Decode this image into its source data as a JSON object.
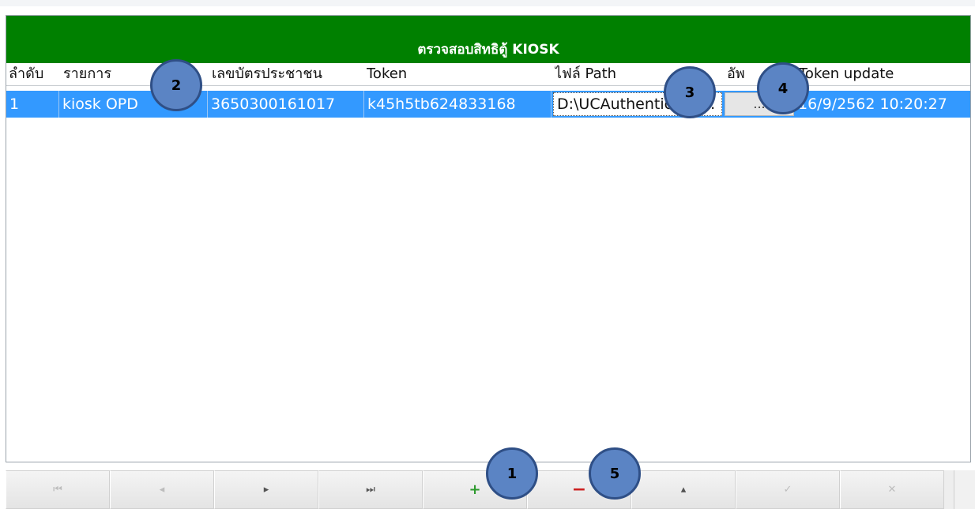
{
  "grid": {
    "title": "ตรวจสอบสิทธิตู้ KIOSK",
    "columns": [
      "ลำดับ",
      "รายการ",
      "เลขบัตรประชาชน",
      "Token",
      "ไฟล์ Path",
      "อัพ",
      "Token update"
    ],
    "row": {
      "seq": "1",
      "item": "kiosk OPD",
      "citizen_id": "3650300161017",
      "token": "k45h5tb624833168",
      "file_path": "D:\\UCAuthentication.",
      "update_button": "...",
      "token_update": "16/9/2562 10:20:27"
    }
  },
  "navigator": {
    "first": "⏮",
    "prior": "◂",
    "next": "▸",
    "last": "⏭",
    "insert": "+",
    "delete": "−",
    "edit": "▴",
    "post": "✓",
    "cancel": "✕"
  },
  "callouts": [
    "1",
    "2",
    "3",
    "4",
    "5"
  ],
  "colors": {
    "title_bar": "#008000",
    "selected_row": "#3399ff",
    "callout_fill": "#5b84c4"
  }
}
